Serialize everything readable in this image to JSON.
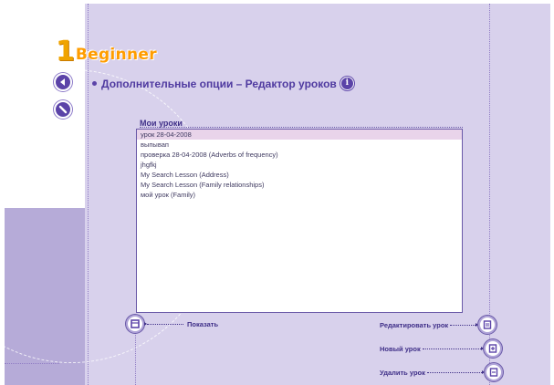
{
  "logo": {
    "number": "1",
    "word": "Beginner"
  },
  "header": {
    "title": "Дополнительные опции – Редактор уроков",
    "info_icon": "i"
  },
  "nav": {
    "back_icon": "back-arrow-icon",
    "help_icon": "help-icon"
  },
  "lessons": {
    "label": "Мои уроки",
    "items": [
      {
        "text": "урок 28-04-2008",
        "selected": true
      },
      {
        "text": "выпывап",
        "selected": false
      },
      {
        "text": "проверка 28-04-2008  (Adverbs of frequency)",
        "selected": false
      },
      {
        "text": "jhgfkj",
        "selected": false
      },
      {
        "text": "My Search Lesson  (Address)",
        "selected": false
      },
      {
        "text": "My Search Lesson  (Family relationships)",
        "selected": false
      },
      {
        "text": "мой урок  (Family)",
        "selected": false
      }
    ]
  },
  "actions": {
    "show": "Показать",
    "edit": "Редактировать урок",
    "new": "Новый урок",
    "delete": "Удалить урок"
  },
  "colors": {
    "accent": "#5b43a8",
    "logo": "#f0a400",
    "background": "#d8d1ec",
    "selection": "#e9d4ea"
  }
}
